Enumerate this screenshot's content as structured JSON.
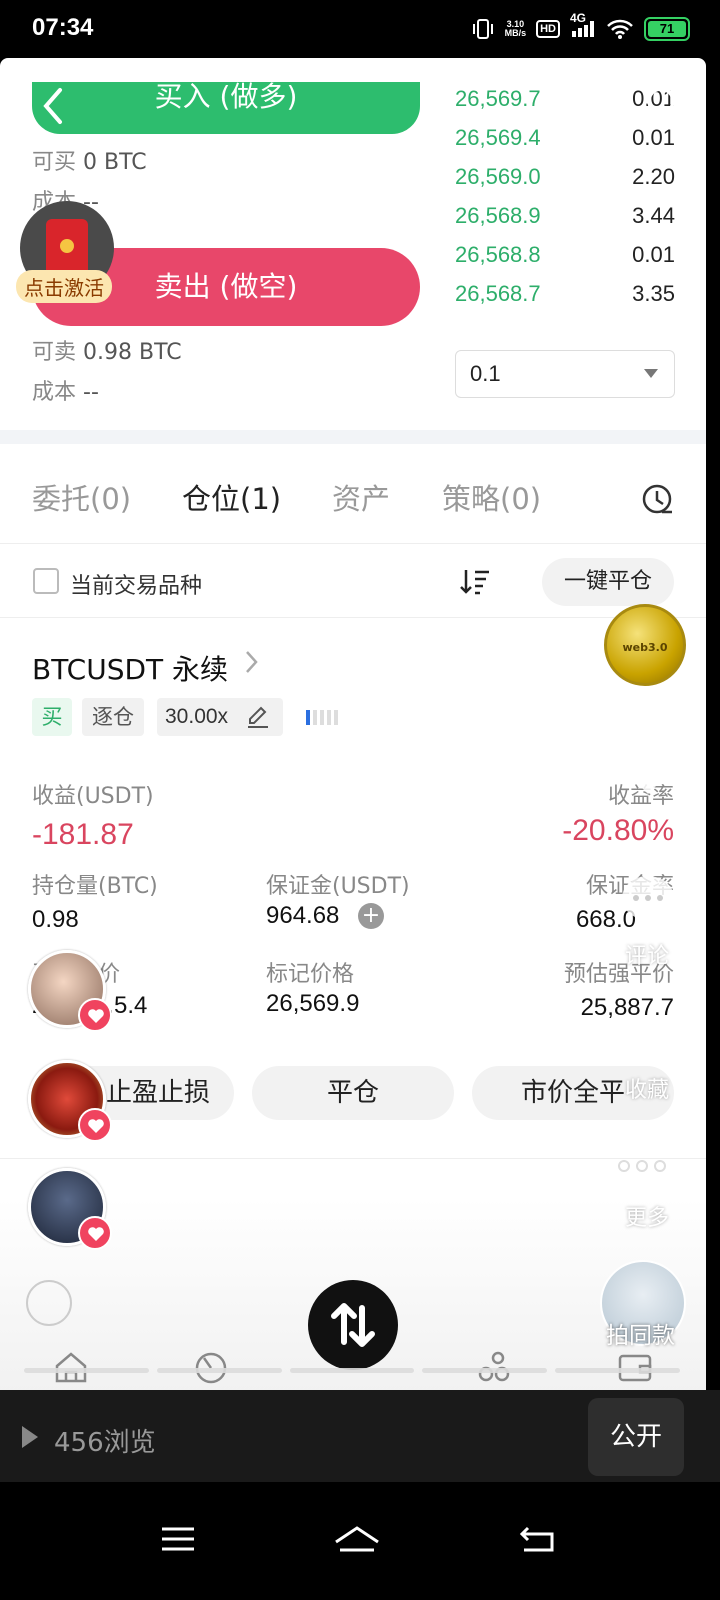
{
  "status_bar": {
    "time": "07:34",
    "net_speed": "3.10",
    "net_unit": "MB/s",
    "hd": "HD",
    "signal": "4G",
    "battery": "71"
  },
  "trade": {
    "buy_label": "买入 (做多)",
    "sell_label": "卖出 (做空)",
    "can_buy_label": "可买",
    "can_buy_value": "0 BTC",
    "buy_cost_label": "成本",
    "buy_cost_value": "--",
    "can_sell_label": "可卖",
    "can_sell_value": "0.98 BTC",
    "sell_cost_label": "成本",
    "sell_cost_value": "--",
    "qty_select_value": "0.1"
  },
  "orderbook": [
    {
      "price": "26,569.7",
      "qty": "0.01"
    },
    {
      "price": "26,569.4",
      "qty": "0.01"
    },
    {
      "price": "26,569.0",
      "qty": "2.20"
    },
    {
      "price": "26,568.9",
      "qty": "3.44"
    },
    {
      "price": "26,568.8",
      "qty": "0.01"
    },
    {
      "price": "26,568.7",
      "qty": "3.35"
    }
  ],
  "promo": {
    "activate_label": "点击激活",
    "coin_label": "web3.0"
  },
  "tabs": [
    "委托(0)",
    "仓位(1)",
    "资产",
    "策略(0)"
  ],
  "filter": {
    "current_label": "当前交易品种",
    "close_all_label": "一键平仓"
  },
  "position": {
    "symbol": "BTCUSDT 永续",
    "side_tag": "买",
    "margin_mode": "逐仓",
    "leverage": "30.00x",
    "adl_level": 1,
    "pnl_label": "收益(USDT)",
    "pnl_value": "-181.87",
    "roe_label": "收益率",
    "roe_value": "-20.80%",
    "size_label": "持仓量(BTC)",
    "size_value": "0.98",
    "margin_label": "保证金(USDT)",
    "margin_value": "964.68",
    "margin_ratio_label": "保证金率",
    "margin_ratio_value": "668.0",
    "entry_label": "开仓均价",
    "entry_value": "2",
    "entry_value_tail": ".5.4",
    "mark_label": "标记价格",
    "mark_value": "26,569.9",
    "liq_label": "预估强平价",
    "liq_value": "25,887.7",
    "tpsl_label": "止盈止损",
    "close_label": "平仓",
    "market_close_label": "市价全平"
  },
  "side_actions": {
    "comment": "评论",
    "collect": "收藏",
    "more": "更多",
    "same_style": "拍同款"
  },
  "footer": {
    "views": "456浏览",
    "public_label": "公开"
  }
}
